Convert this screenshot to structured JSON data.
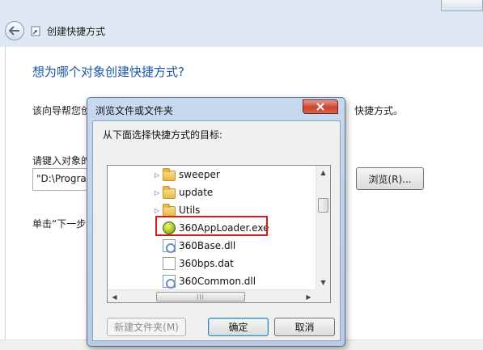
{
  "wizard": {
    "title": "创建快捷方式",
    "heading": "想为哪个对象创建快捷方式?",
    "description_left": "该向导帮您创",
    "description_right": "快捷方式。",
    "location_label": "请键入对象的",
    "location_value": "\"D:\\Program",
    "browse_label": "浏览(R)...",
    "hint": "单击“下一步"
  },
  "dialog": {
    "title": "浏览文件或文件夹",
    "instruction": "从下面选择快捷方式的目标:",
    "tree": [
      {
        "label": "sweeper",
        "icon": "folder-icon",
        "expandable": true
      },
      {
        "label": "update",
        "icon": "folder-icon",
        "expandable": true
      },
      {
        "label": "Utils",
        "icon": "folder-icon",
        "expandable": true
      },
      {
        "label": "360AppLoader.exe",
        "icon": "exe-icon",
        "expandable": false,
        "highlighted": true
      },
      {
        "label": "360Base.dll",
        "icon": "dll-icon",
        "expandable": false
      },
      {
        "label": "360bps.dat",
        "icon": "dat-icon",
        "expandable": false
      },
      {
        "label": "360Common.dll",
        "icon": "dll-icon",
        "expandable": false
      }
    ],
    "buttons": {
      "new_folder": "新建文件夹(M)",
      "ok": "确定",
      "cancel": "取消"
    }
  },
  "colors": {
    "heading": "#1d55a5",
    "highlight_border": "#d81a1a",
    "dialog_frame": "#c8d9ee",
    "close_button": "#c9452e"
  }
}
